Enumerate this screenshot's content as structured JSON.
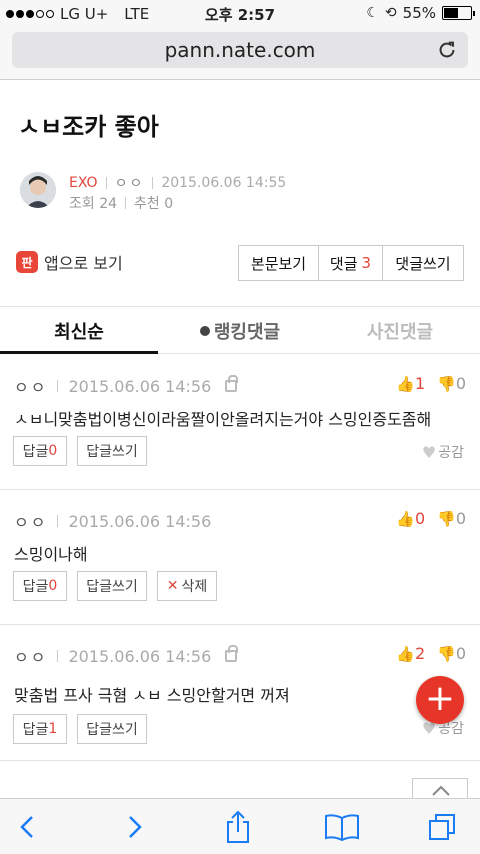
{
  "status": {
    "carrier": "LG U+",
    "network": "LTE",
    "time": "오후 2:57",
    "battery": "55%",
    "battery_level": 0.55
  },
  "browser": {
    "url": "pann.nate.com"
  },
  "post": {
    "title": "ㅅㅂ조카 좋아",
    "author": "EXO",
    "nickname": "ㅇㅇ",
    "datetime": "2015.06.06 14:55",
    "views": "조회 24",
    "recommend": "추천 0"
  },
  "app": {
    "label": "앱으로 보기",
    "icon_text": "판"
  },
  "actions": {
    "view_body": "본문보기",
    "comments_label": "댓글",
    "comments_count": "3",
    "write_comment": "댓글쓰기"
  },
  "tabs": {
    "latest": "최신순",
    "ranking": "랭킹댓글",
    "photo": "사진댓글"
  },
  "comments": [
    {
      "nick": "ㅇㅇ",
      "date": "2015.06.06 14:56",
      "up": "1",
      "down": "0",
      "text": "ㅅㅂ니맞춤법이병신이라움짤이안올려지는거야 스밍인증도좀해",
      "reply_label": "답글",
      "reply_count": "0",
      "write_reply": "답글쓰기",
      "like": "공감"
    },
    {
      "nick": "ㅇㅇ",
      "date": "2015.06.06 14:56",
      "up": "0",
      "down": "0",
      "text": "스밍이나해",
      "reply_label": "답글",
      "reply_count": "0",
      "write_reply": "답글쓰기",
      "delete": "삭제"
    },
    {
      "nick": "ㅇㅇ",
      "date": "2015.06.06 14:56",
      "up": "2",
      "down": "0",
      "text": "맞춤법 프사 극혐 ㅅㅂ 스밍안할거면 꺼져",
      "reply_label": "답글",
      "reply_count": "1",
      "write_reply": "답글쓰기",
      "like": "공감"
    }
  ],
  "fab": {
    "label": "+"
  },
  "colors": {
    "accent": "#e0463c",
    "fab": "#e8352a"
  }
}
